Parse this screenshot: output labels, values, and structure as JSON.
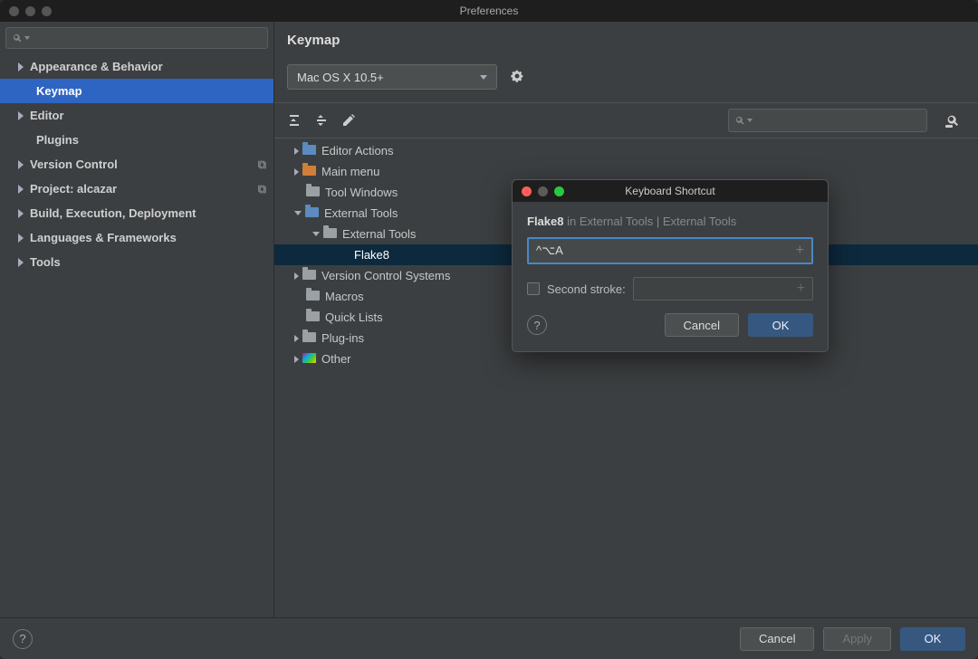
{
  "window": {
    "title": "Preferences"
  },
  "sidebar": {
    "items": [
      {
        "label": "Appearance & Behavior"
      },
      {
        "label": "Keymap"
      },
      {
        "label": "Editor"
      },
      {
        "label": "Plugins"
      },
      {
        "label": "Version Control"
      },
      {
        "label": "Project: alcazar"
      },
      {
        "label": "Build, Execution, Deployment"
      },
      {
        "label": "Languages & Frameworks"
      },
      {
        "label": "Tools"
      }
    ]
  },
  "main": {
    "title": "Keymap",
    "scheme": "Mac OS X 10.5+"
  },
  "tree": [
    "Editor Actions",
    "Main menu",
    "Tool Windows",
    "External Tools",
    "External Tools",
    "Flake8",
    "Version Control Systems",
    "Macros",
    "Quick Lists",
    "Plug-ins",
    "Other"
  ],
  "dialog": {
    "title": "Keyboard Shortcut",
    "action": "Flake8",
    "context": "in External Tools | External Tools",
    "first_stroke": "^⌥A",
    "second_label": "Second stroke:",
    "cancel": "Cancel",
    "ok": "OK"
  },
  "footer": {
    "cancel": "Cancel",
    "apply": "Apply",
    "ok": "OK"
  }
}
